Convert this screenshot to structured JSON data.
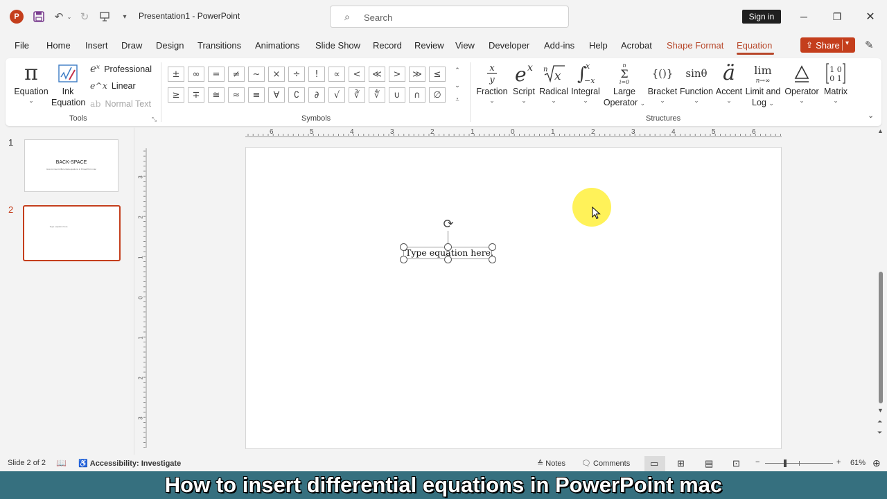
{
  "app": {
    "title": "Presentation1  -  PowerPoint",
    "search_placeholder": "Search",
    "sign_in": "Sign in"
  },
  "menu": {
    "items": [
      "File",
      "Home",
      "Insert",
      "Draw",
      "Design",
      "Transitions",
      "Animations",
      "Slide Show",
      "Record",
      "Review",
      "View",
      "Developer",
      "Add-ins",
      "Help",
      "Acrobat",
      "Shape Format",
      "Equation"
    ],
    "active": "Equation",
    "share": "Share"
  },
  "ribbon": {
    "tools": {
      "label": "Tools",
      "equation": "Equation",
      "ink_equation_line1": "Ink",
      "ink_equation_line2": "Equation",
      "professional": "Professional",
      "linear": "Linear",
      "normal_text": "Normal Text"
    },
    "symbols": {
      "label": "Symbols",
      "row1": [
        "±",
        "∞",
        "=",
        "≠",
        "~",
        "×",
        "÷",
        "!",
        "∝",
        "<",
        "≪",
        ">",
        "≫",
        "≤"
      ],
      "row2": [
        "≥",
        "∓",
        "≅",
        "≈",
        "≡",
        "∀",
        "∁",
        "∂",
        "√",
        "∛",
        "∜",
        "∪",
        "∩",
        "∅"
      ]
    },
    "structures": {
      "label": "Structures",
      "fraction": "Fraction",
      "script": "Script",
      "radical": "Radical",
      "integral": "Integral",
      "large_operator_1": "Large",
      "large_operator_2": "Operator",
      "bracket": "Bracket",
      "function": "Function",
      "accent": "Accent",
      "limit_log_1": "Limit and",
      "limit_log_2": "Log",
      "operator": "Operator",
      "matrix": "Matrix"
    }
  },
  "slides": [
    {
      "number": "1",
      "title": "BACK-SPACE",
      "subtitle": "How to insert differential equations in PowerPoint mac"
    },
    {
      "number": "2",
      "placeholder": "Type equation here."
    }
  ],
  "slide": {
    "equation_placeholder": "Type equation here."
  },
  "ruler": {
    "horizontal": [
      "6",
      "5",
      "4",
      "3",
      "2",
      "1",
      "0",
      "1",
      "2",
      "3",
      "4",
      "5",
      "6"
    ],
    "vertical": [
      "3",
      "2",
      "1",
      "0",
      "1",
      "2",
      "3"
    ]
  },
  "status": {
    "slide_of": "Slide 2 of 2",
    "accessibility": "Accessibility: Investigate",
    "notes": "Notes",
    "comments": "Comments",
    "zoom": "61%"
  },
  "caption": "How to insert differential equations in PowerPoint mac"
}
